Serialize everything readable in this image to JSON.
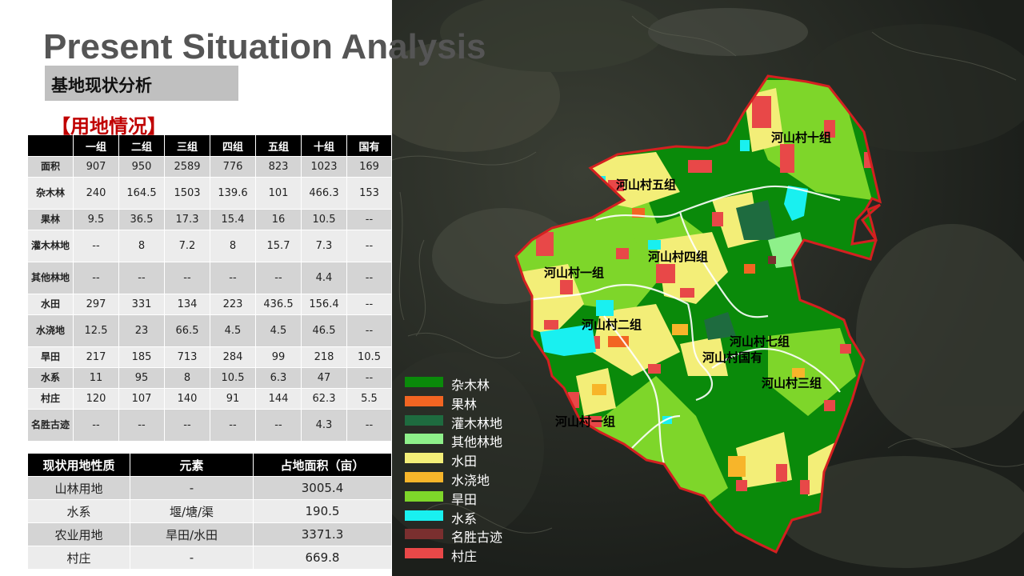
{
  "header": {
    "title_en": "Present Situation Analysis",
    "title_cn": "基地现状分析",
    "section": "【用地情况】"
  },
  "table1": {
    "columns": [
      "",
      "一组",
      "二组",
      "三组",
      "四组",
      "五组",
      "十组",
      "国有"
    ],
    "rows": [
      {
        "label": "面积",
        "values": [
          "907",
          "950",
          "2589",
          "776",
          "823",
          "1023",
          "169"
        ]
      },
      {
        "label": "杂木林",
        "values": [
          "240",
          "164.5",
          "1503",
          "139.6",
          "101",
          "466.3",
          "153"
        ]
      },
      {
        "label": "果林",
        "values": [
          "9.5",
          "36.5",
          "17.3",
          "15.4",
          "16",
          "10.5",
          "--"
        ]
      },
      {
        "label": "灌木林地",
        "values": [
          "--",
          "8",
          "7.2",
          "8",
          "15.7",
          "7.3",
          "--"
        ]
      },
      {
        "label": "其他林地",
        "values": [
          "--",
          "--",
          "--",
          "--",
          "--",
          "4.4",
          "--"
        ]
      },
      {
        "label": "水田",
        "values": [
          "297",
          "331",
          "134",
          "223",
          "436.5",
          "156.4",
          "--"
        ]
      },
      {
        "label": "水浇地",
        "values": [
          "12.5",
          "23",
          "66.5",
          "4.5",
          "4.5",
          "46.5",
          "--"
        ]
      },
      {
        "label": "旱田",
        "values": [
          "217",
          "185",
          "713",
          "284",
          "99",
          "218",
          "10.5"
        ]
      },
      {
        "label": "水系",
        "values": [
          "11",
          "95",
          "8",
          "10.5",
          "6.3",
          "47",
          "--"
        ]
      },
      {
        "label": "村庄",
        "values": [
          "120",
          "107",
          "140",
          "91",
          "144",
          "62.3",
          "5.5"
        ]
      },
      {
        "label": "名胜古迹",
        "values": [
          "--",
          "--",
          "--",
          "--",
          "--",
          "4.3",
          "--"
        ]
      }
    ]
  },
  "table2": {
    "columns": [
      "现状用地性质",
      "元素",
      "占地面积（亩）"
    ],
    "rows": [
      [
        "山林用地",
        "-",
        "3005.4"
      ],
      [
        "水系",
        "堰/塘/渠",
        "190.5"
      ],
      [
        "农业用地",
        "旱田/水田",
        "3371.3"
      ],
      [
        "村庄",
        "-",
        "669.8"
      ]
    ]
  },
  "map": {
    "labels": [
      "河山村十组",
      "河山村五组",
      "河山村四组",
      "河山村一组",
      "河山村二组",
      "河山村七组",
      "河山村国有",
      "河山村三组",
      "河山村一组"
    ]
  },
  "legend": [
    {
      "label": "杂木林",
      "color": "#0a8a0a"
    },
    {
      "label": "果林",
      "color": "#f26522"
    },
    {
      "label": "灌木林地",
      "color": "#1e6b3f"
    },
    {
      "label": "其他林地",
      "color": "#8ef08a"
    },
    {
      "label": "水田",
      "color": "#f3ee78"
    },
    {
      "label": "水浇地",
      "color": "#f7b52a"
    },
    {
      "label": "旱田",
      "color": "#7ed62a"
    },
    {
      "label": "水系",
      "color": "#19f0f0"
    },
    {
      "label": "名胜古迹",
      "color": "#7a2f2f"
    },
    {
      "label": "村庄",
      "color": "#e84848"
    }
  ]
}
